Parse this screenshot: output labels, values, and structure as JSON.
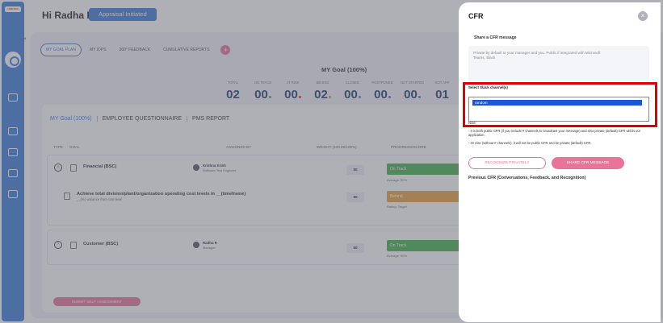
{
  "sidebar": {
    "logo_text": "UNIFYED",
    "icons": [
      "logout-icon",
      "settings-icon",
      "document-icon",
      "chat-icon",
      "info-icon",
      "team-icon",
      "mail-icon"
    ]
  },
  "header": {
    "greeting": "Hi Radha R",
    "status_badge": "Appraisal Initiated"
  },
  "topnav": {
    "tabs": [
      "MY GOAL PLAN",
      "MY IDPS",
      "360° FEEDBACK",
      "CUMULATIVE REPORTS"
    ],
    "add_label": "+"
  },
  "goal": {
    "heading": "MY Goal (100%)",
    "stats": [
      {
        "label": "TOTAL",
        "value": "02",
        "color": ""
      },
      {
        "label": "ON TRACK",
        "value": "00",
        "color": "#3aa86b"
      },
      {
        "label": "AT RISK",
        "value": "00",
        "color": "#e53935"
      },
      {
        "label": "BEHIND",
        "value": "02",
        "color": "#e8873a"
      },
      {
        "label": "CLOSED",
        "value": "00",
        "color": "#3b7dd8"
      },
      {
        "label": "POSTPONED",
        "value": "00",
        "color": "#3b7dd8"
      },
      {
        "label": "NOT STARTED",
        "value": "00",
        "color": "#3b7dd8"
      },
      {
        "label": "NOT APP",
        "value": "01",
        "color": ""
      }
    ]
  },
  "card": {
    "tabs": [
      "MY Goal (100%)",
      "EMPLOYEE QUESTIONNAIRE",
      "PMS REPORT"
    ],
    "columns": [
      "TYPE",
      "GOAL",
      "ASSIGNED BY",
      "WEIGHT (100.00/100%)",
      "PROGRESS/SCORE"
    ],
    "rows": [
      {
        "title": "Financial (BSC)",
        "assigner": "Krishna Krish",
        "assigner_role": "Software Test Engineer",
        "weight": "50",
        "status": "On Track",
        "status_sub": "Average: 50%",
        "status_color": "#43b04a"
      },
      {
        "title": "Achieve total division/plant/organization operating cost levels in __(timeframe)",
        "subtitle": "__(%) variance from cost level",
        "weight": "50",
        "status": "Behind",
        "status_sub": "Rating: Target",
        "status_color": "#e8a33a"
      },
      {
        "title": "Customer (BSC)",
        "assigner": "Radha R",
        "assigner_role": "Manager",
        "weight": "50",
        "status": "On Track",
        "status_sub": "Average: 50%",
        "status_color": "#43b04a"
      }
    ],
    "submit_label": "SUBMIT SELF ASSESSMENT"
  },
  "panel": {
    "title": "CFR",
    "close": "×",
    "share_label": "Share a CFR message",
    "message_placeholder": "Private by default to your manager and you. Public if integrated with Microsoft Teams, Slack",
    "slack_label": "Select Slack channel(s)",
    "slack_selected": "random",
    "note_label": "Note:",
    "note_1": "- It is both public CFR (if you include # channels to broadcast your message) and also private (default) CFR within our application.",
    "note_2": "- Or else (without # channels), it will not be public CFR and be private (default) CFR.",
    "btn_private": "RECOGNIZE PRIVATELY",
    "btn_share": "SHARE CFR MESSAGE",
    "previous_label": "Previous CFR (Conversations, Feedback, and Recognition)"
  }
}
